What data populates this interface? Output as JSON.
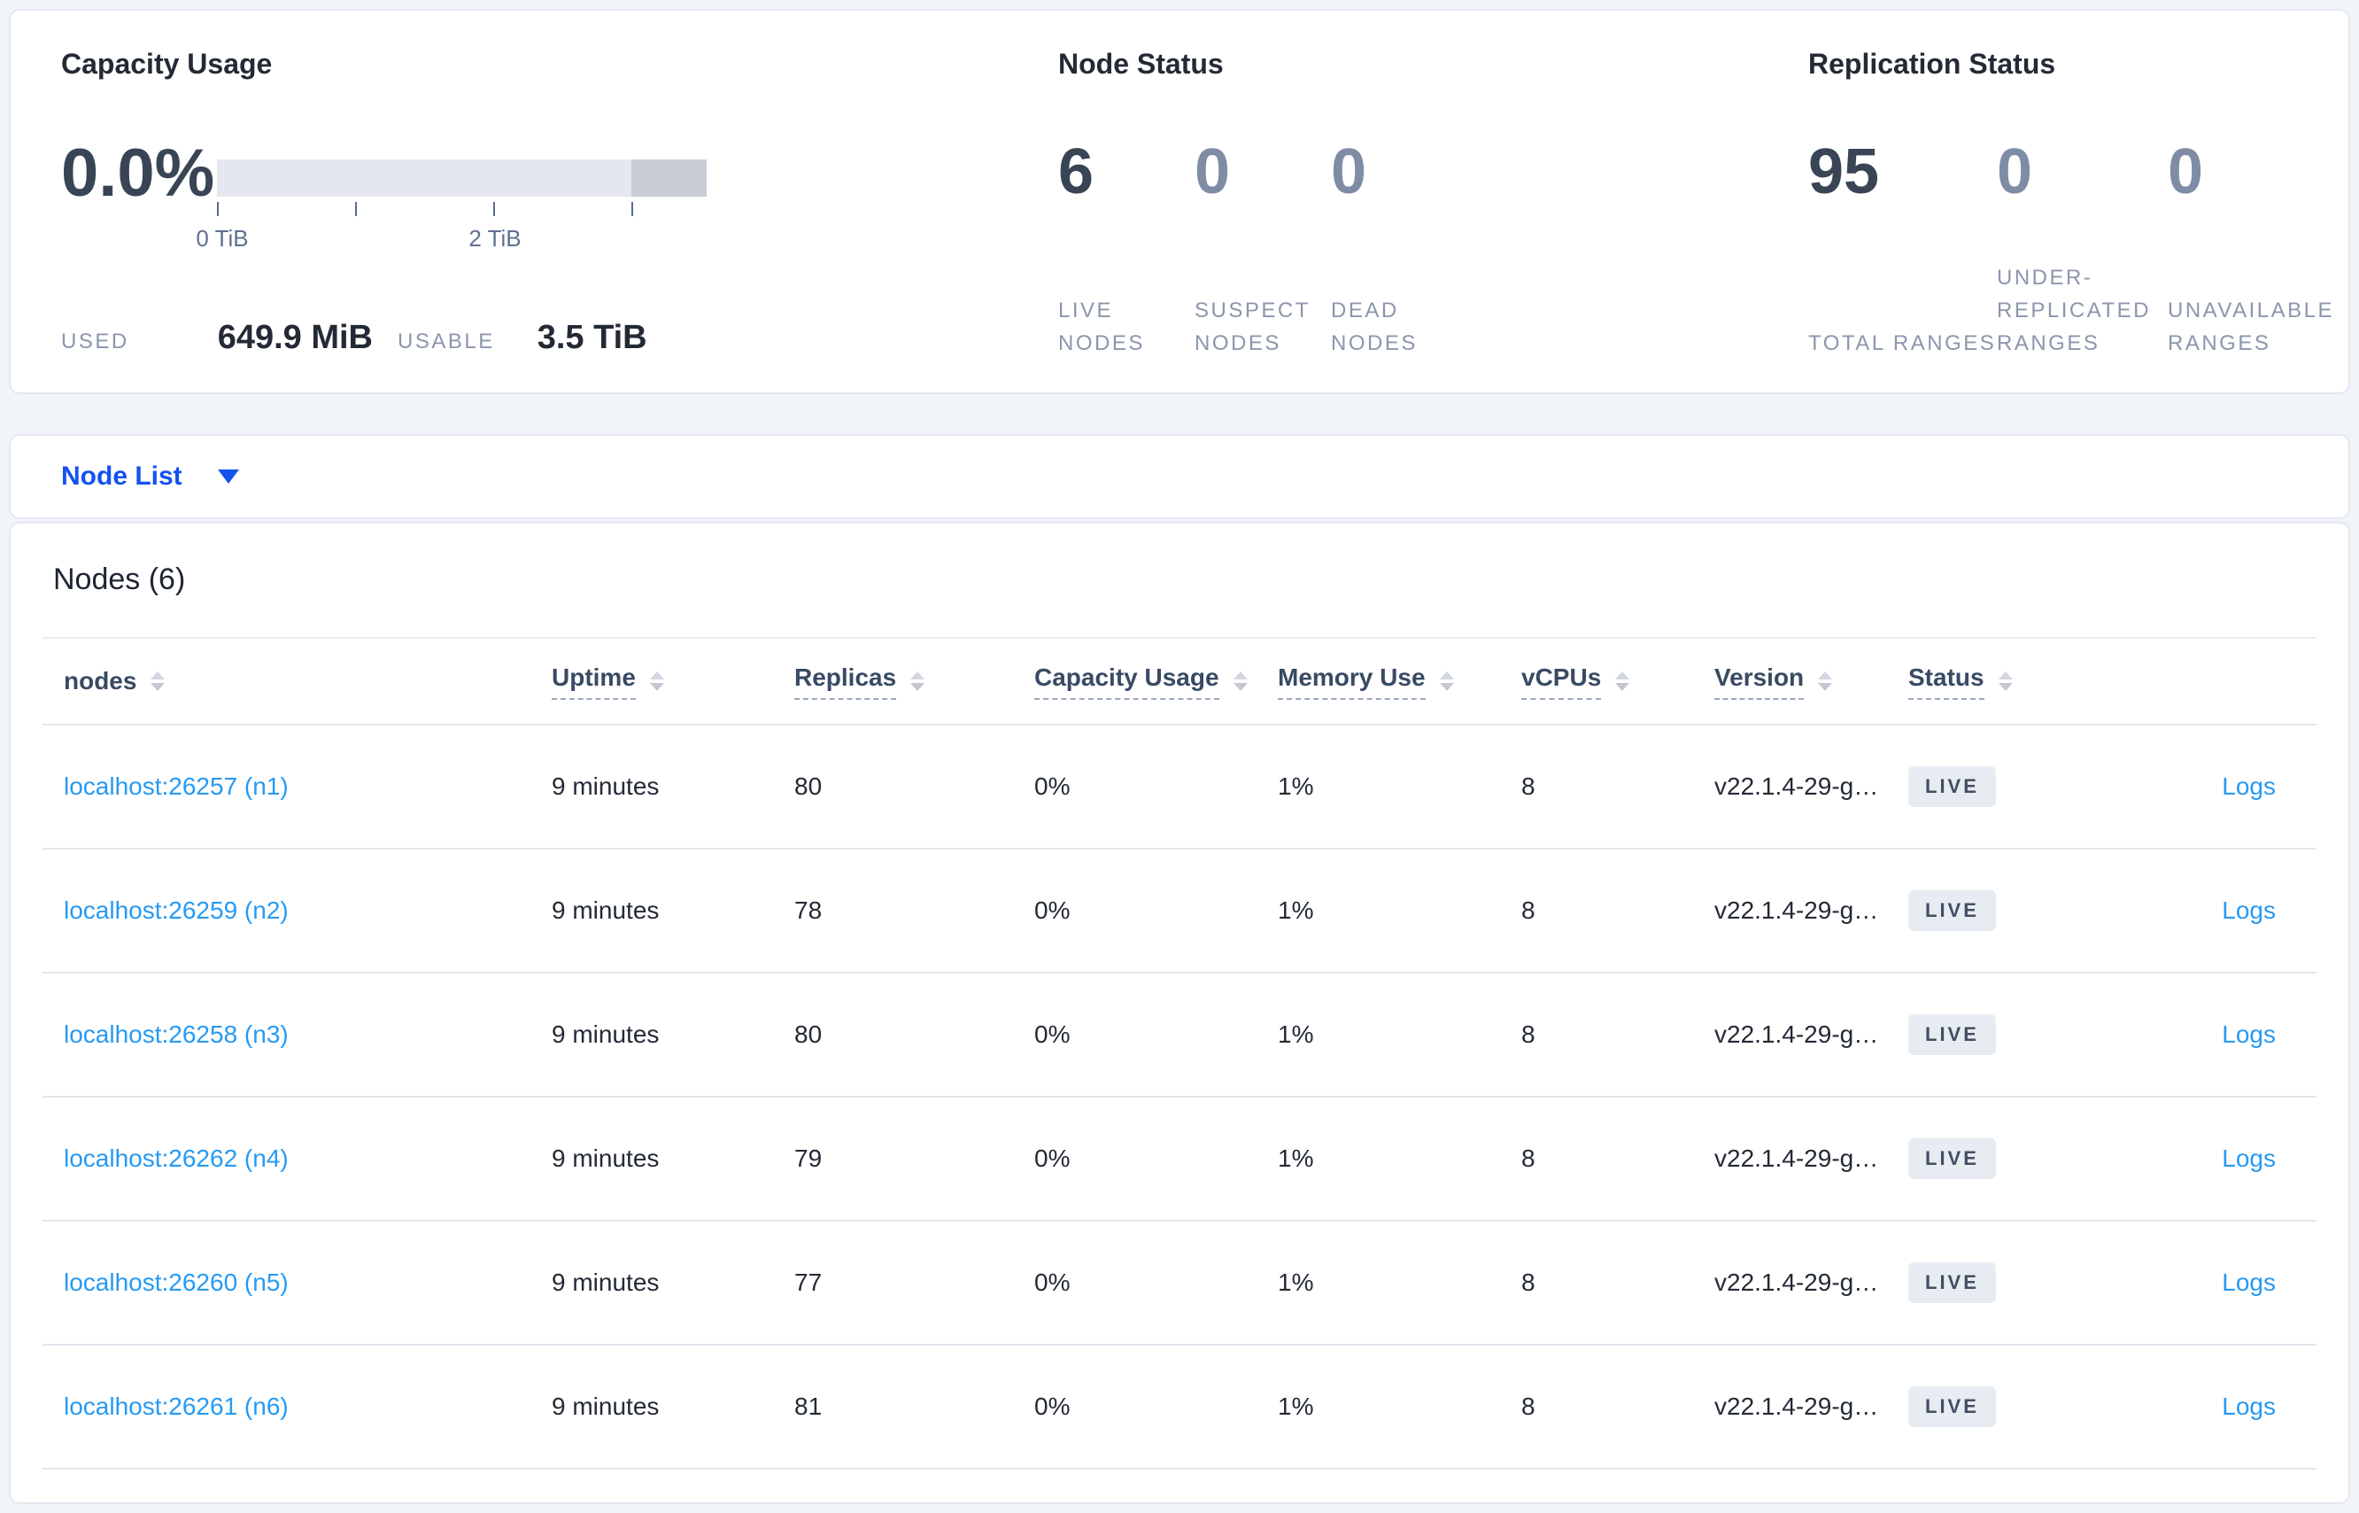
{
  "summary": {
    "capacity": {
      "title": "Capacity Usage",
      "percent": "0.0%",
      "used_label": "USED",
      "used_value": "649.9 MiB",
      "usable_label": "USABLE",
      "usable_value": "3.5 TiB",
      "chart": {
        "type": "bar",
        "domain_tib": [
          0,
          3.5
        ],
        "ticks_tib": [
          0,
          1,
          2,
          3
        ],
        "tick_labels": [
          "0 TiB",
          "2 TiB"
        ],
        "segments": [
          {
            "from_tib": 0,
            "to_tib": 3.0,
            "color": "#E4E7ED"
          },
          {
            "from_tib": 3.0,
            "to_tib": 3.5,
            "color": "#C9CDD8"
          }
        ]
      }
    },
    "node_status": {
      "title": "Node Status",
      "metrics": [
        {
          "value": "6",
          "label": "LIVE NODES"
        },
        {
          "value": "0",
          "label": "SUSPECT NODES"
        },
        {
          "value": "0",
          "label": "DEAD NODES"
        }
      ]
    },
    "replication": {
      "title": "Replication Status",
      "metrics": [
        {
          "value": "95",
          "label": "TOTAL RANGES"
        },
        {
          "value": "0",
          "label": "UNDER-REPLICATED RANGES"
        },
        {
          "value": "0",
          "label": "UNAVAILABLE RANGES"
        }
      ]
    }
  },
  "view_selector": {
    "label": "Node List"
  },
  "table": {
    "title": "Nodes (6)",
    "columns": [
      {
        "key": "nodes",
        "label": "nodes",
        "sortable": true,
        "tooltip": false
      },
      {
        "key": "uptime",
        "label": "Uptime",
        "sortable": true,
        "tooltip": true
      },
      {
        "key": "replicas",
        "label": "Replicas",
        "sortable": true,
        "tooltip": true
      },
      {
        "key": "capacity_usage",
        "label": "Capacity Usage",
        "sortable": true,
        "tooltip": true
      },
      {
        "key": "memory_use",
        "label": "Memory Use",
        "sortable": true,
        "tooltip": true
      },
      {
        "key": "vcpus",
        "label": "vCPUs",
        "sortable": true,
        "tooltip": true
      },
      {
        "key": "version",
        "label": "Version",
        "sortable": true,
        "tooltip": true
      },
      {
        "key": "status",
        "label": "Status",
        "sortable": true,
        "tooltip": true
      },
      {
        "key": "logs",
        "label": "",
        "sortable": false,
        "tooltip": false
      }
    ],
    "rows": [
      {
        "address": "localhost:26257 (n1)",
        "uptime": "9 minutes",
        "replicas": "80",
        "capacity_usage": "0%",
        "memory_use": "1%",
        "vcpus": "8",
        "version": "v22.1.4-29-g…",
        "status": "LIVE",
        "logs": "Logs"
      },
      {
        "address": "localhost:26259 (n2)",
        "uptime": "9 minutes",
        "replicas": "78",
        "capacity_usage": "0%",
        "memory_use": "1%",
        "vcpus": "8",
        "version": "v22.1.4-29-g…",
        "status": "LIVE",
        "logs": "Logs"
      },
      {
        "address": "localhost:26258 (n3)",
        "uptime": "9 minutes",
        "replicas": "80",
        "capacity_usage": "0%",
        "memory_use": "1%",
        "vcpus": "8",
        "version": "v22.1.4-29-g…",
        "status": "LIVE",
        "logs": "Logs"
      },
      {
        "address": "localhost:26262 (n4)",
        "uptime": "9 minutes",
        "replicas": "79",
        "capacity_usage": "0%",
        "memory_use": "1%",
        "vcpus": "8",
        "version": "v22.1.4-29-g…",
        "status": "LIVE",
        "logs": "Logs"
      },
      {
        "address": "localhost:26260 (n5)",
        "uptime": "9 minutes",
        "replicas": "77",
        "capacity_usage": "0%",
        "memory_use": "1%",
        "vcpus": "8",
        "version": "v22.1.4-29-g…",
        "status": "LIVE",
        "logs": "Logs"
      },
      {
        "address": "localhost:26261 (n6)",
        "uptime": "9 minutes",
        "replicas": "81",
        "capacity_usage": "0%",
        "memory_use": "1%",
        "vcpus": "8",
        "version": "v22.1.4-29-g…",
        "status": "LIVE",
        "logs": "Logs"
      }
    ]
  },
  "colors": {
    "accent_blue": "#1352EF",
    "link_blue": "#269AF3",
    "badge_bg": "#E7EBF2",
    "badge_text": "#434E63",
    "bar_light": "#E4E7ED",
    "bar_dark": "#C9CDD8"
  }
}
